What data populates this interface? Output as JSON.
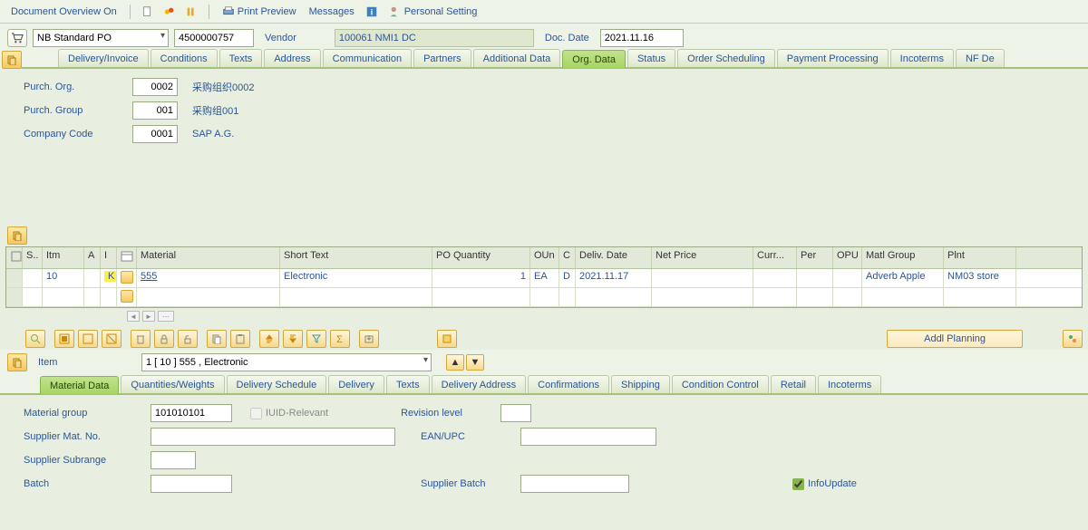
{
  "toolbar": {
    "doc_overview": "Document Overview On",
    "print_preview": "Print Preview",
    "messages": "Messages",
    "personal_setting": "Personal Setting"
  },
  "header": {
    "po_type": "NB Standard PO",
    "po_number": "4500000757",
    "vendor_label": "Vendor",
    "vendor_value": "100061 NMI1 DC",
    "doc_date_label": "Doc. Date",
    "doc_date_value": "2021.11.16"
  },
  "header_tabs": [
    "Delivery/Invoice",
    "Conditions",
    "Texts",
    "Address",
    "Communication",
    "Partners",
    "Additional Data",
    "Org. Data",
    "Status",
    "Order Scheduling",
    "Payment Processing",
    "Incoterms",
    "NF De"
  ],
  "header_active_tab": 7,
  "org_data": {
    "purch_org_label": "Purch. Org.",
    "purch_org_value": "0002",
    "purch_org_desc": "采购组织0002",
    "purch_group_label": "Purch. Group",
    "purch_group_value": "001",
    "purch_group_desc": "采购组001",
    "company_code_label": "Company Code",
    "company_code_value": "0001",
    "company_code_desc": "SAP A.G."
  },
  "grid": {
    "columns": [
      "S..",
      "Itm",
      "A",
      "I",
      "",
      "Material",
      "Short Text",
      "PO Quantity",
      "OUn",
      "C",
      "Deliv. Date",
      "Net Price",
      "Curr...",
      "Per",
      "OPU",
      "Matl Group",
      "Plnt"
    ],
    "rows": [
      {
        "sel": "",
        "itm": "10",
        "a": "",
        "i": "K",
        "icon": "",
        "material": "555",
        "short_text": "Electronic",
        "po_qty": "1",
        "oun": "EA",
        "c": "D",
        "deliv_date": "2021.11.17",
        "net_price": "",
        "curr": "",
        "per": "",
        "opu": "",
        "matl_group": "Adverb Apple",
        "plnt": "NM03 store"
      },
      {
        "sel": "",
        "itm": "",
        "a": "",
        "i": "",
        "icon": "",
        "material": "",
        "short_text": "",
        "po_qty": "",
        "oun": "",
        "c": "",
        "deliv_date": "",
        "net_price": "",
        "curr": "",
        "per": "",
        "opu": "",
        "matl_group": "",
        "plnt": ""
      }
    ],
    "addl_planning": "Addl Planning"
  },
  "item_section": {
    "item_label": "Item",
    "item_select": "1 [ 10 ] 555 , Electronic"
  },
  "item_tabs": [
    "Material Data",
    "Quantities/Weights",
    "Delivery Schedule",
    "Delivery",
    "Texts",
    "Delivery Address",
    "Confirmations",
    "Shipping",
    "Condition Control",
    "Retail",
    "Incoterms"
  ],
  "item_active_tab": 0,
  "material_data": {
    "material_group_label": "Material group",
    "material_group_value": "101010101",
    "iuid_relevant": "IUID-Relevant",
    "revision_level_label": "Revision level",
    "revision_level_value": "",
    "supplier_mat_no_label": "Supplier Mat. No.",
    "supplier_mat_no_value": "",
    "ean_upc_label": "EAN/UPC",
    "ean_upc_value": "",
    "supplier_subrange_label": "Supplier Subrange",
    "supplier_subrange_value": "",
    "batch_label": "Batch",
    "batch_value": "",
    "supplier_batch_label": "Supplier Batch",
    "supplier_batch_value": "",
    "info_update": "InfoUpdate"
  }
}
